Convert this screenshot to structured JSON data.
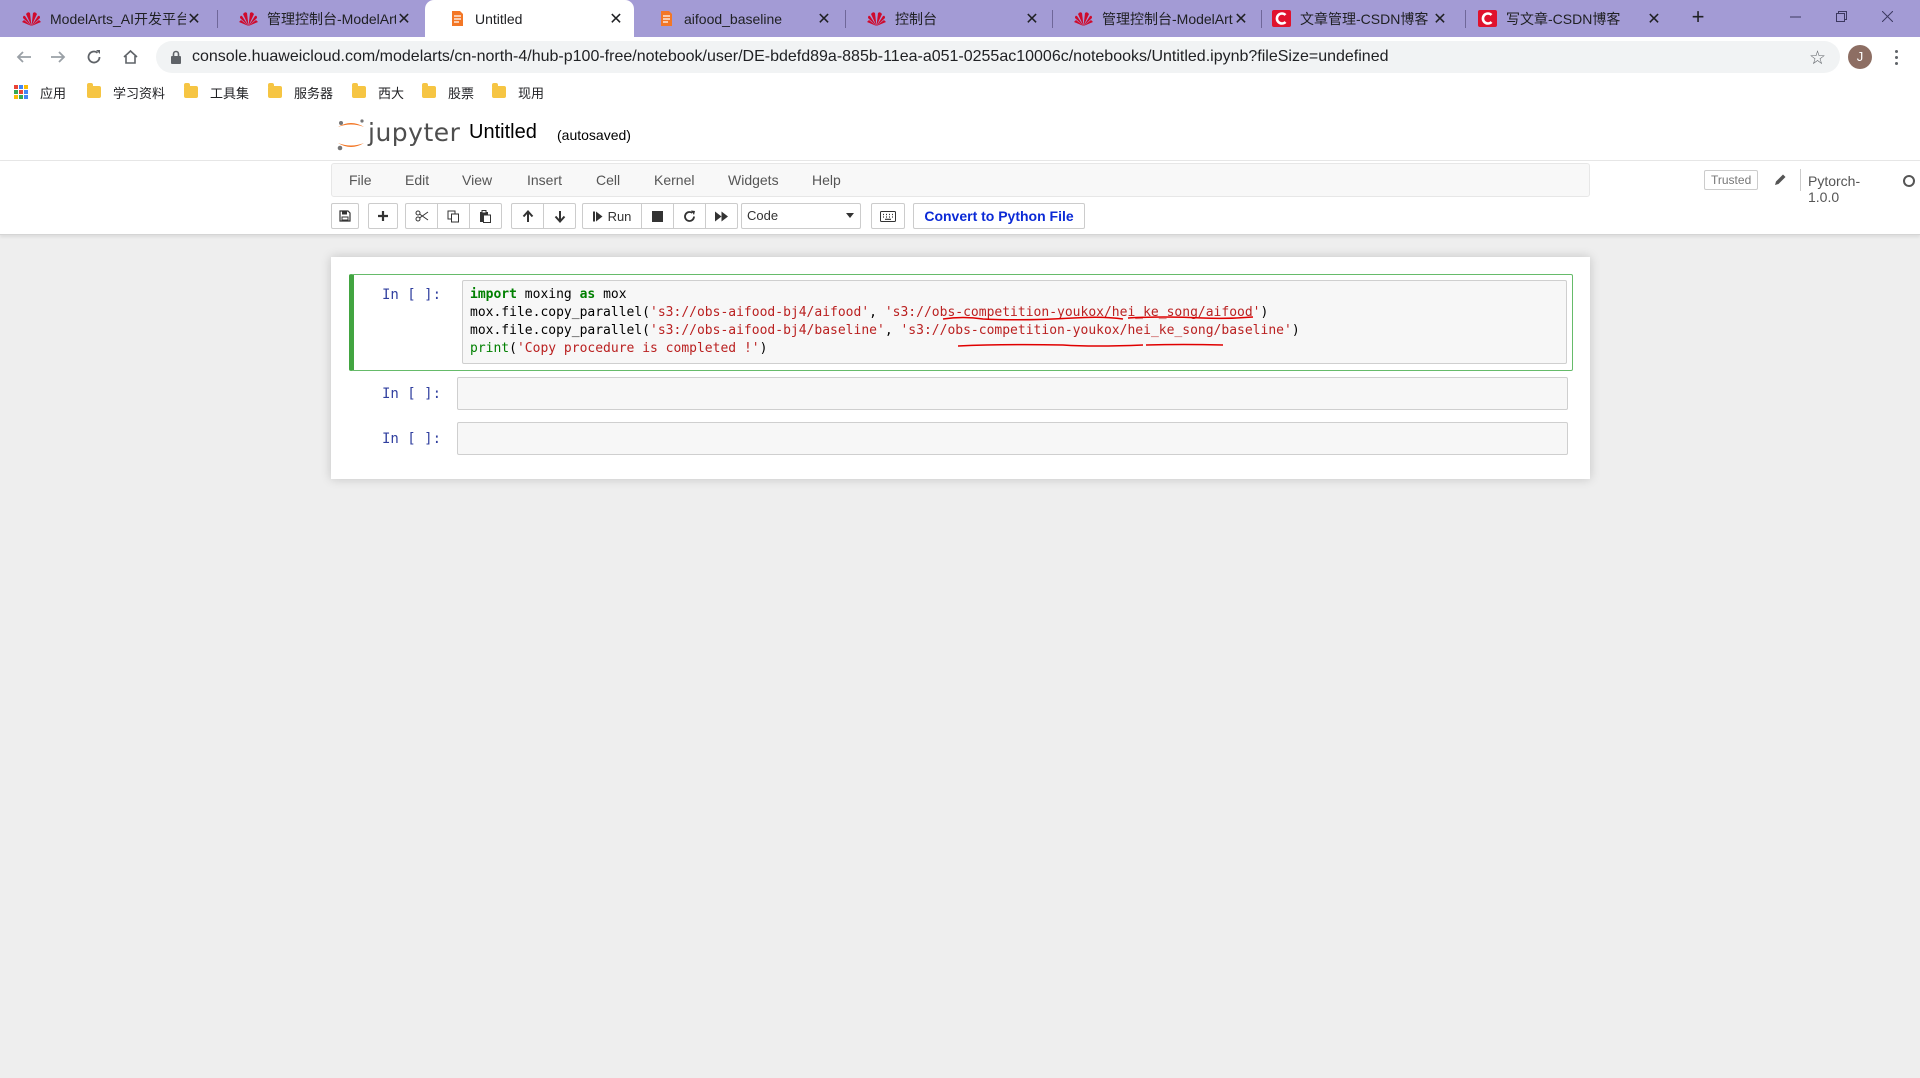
{
  "browser": {
    "tabs": [
      {
        "title": "ModelArts_AI开发平台",
        "favicon": "huawei-icon",
        "active": false
      },
      {
        "title": "管理控制台-ModelArts",
        "favicon": "huawei-icon",
        "active": false
      },
      {
        "title": "Untitled",
        "favicon": "jupyter-icon",
        "active": true
      },
      {
        "title": "aifood_baseline",
        "favicon": "jupyter-icon",
        "active": false
      },
      {
        "title": "控制台",
        "favicon": "huawei-icon",
        "active": false
      },
      {
        "title": "管理控制台-ModelArts",
        "favicon": "huawei-icon",
        "active": false
      },
      {
        "title": "文章管理-CSDN博客",
        "favicon": "csdn-icon",
        "active": false
      },
      {
        "title": "写文章-CSDN博客",
        "favicon": "csdn-icon",
        "active": false
      }
    ],
    "url": "console.huaweicloud.com/modelarts/cn-north-4/hub-p100-free/notebook/user/DE-bdefd89a-885b-11ea-a051-0255ac10006c/notebooks/Untitled.ipynb?fileSize=undefined",
    "profile_initial": "J",
    "bookmarks": [
      "应用",
      "学习资料",
      "工具集",
      "服务器",
      "西大",
      "股票",
      "现用"
    ]
  },
  "jupyter": {
    "logo_text": "jupyter",
    "notebook_name": "Untitled",
    "save_status": "(autosaved)",
    "menu": [
      "File",
      "Edit",
      "View",
      "Insert",
      "Cell",
      "Kernel",
      "Widgets",
      "Help"
    ],
    "trusted": "Trusted",
    "kernel": "Pytorch-1.0.0",
    "toolbar": {
      "run_label": "Run",
      "cell_type": "Code",
      "convert_label": "Convert to Python File"
    },
    "cells": [
      {
        "prompt": "In [ ]:",
        "lines": [
          "import moxing as mox",
          "mox.file.copy_parallel('s3://obs-aifood-bj4/aifood', 's3://obs-competition-youkox/hei_ke_song/aifood')",
          "mox.file.copy_parallel('s3://obs-aifood-bj4/baseline', 's3://obs-competition-youkox/hei_ke_song/baseline')",
          "print('Copy procedure is completed !')"
        ],
        "code_parts": {
          "l1_import": "import",
          "l1_mod": " moxing ",
          "l1_as": "as",
          "l1_alias": " mox",
          "l2_fn": "mox.file.copy_parallel(",
          "l2_src": "'s3://obs-aifood-bj4/aifood'",
          "l2_sep": ", ",
          "l2_dst": "'s3://obs-competition-youkox/hei_ke_song/aifood'",
          "l2_end": ")",
          "l3_fn": "mox.file.copy_parallel(",
          "l3_src": "'s3://obs-aifood-bj4/baseline'",
          "l3_sep": ", ",
          "l3_dst": "'s3://obs-competition-youkox/hei_ke_song/baseline'",
          "l3_end": ")",
          "l4_print": "print",
          "l4_open": "(",
          "l4_str": "'Copy procedure is completed !'",
          "l4_end": ")"
        }
      },
      {
        "prompt": "In [ ]:",
        "lines": []
      },
      {
        "prompt": "In [ ]:",
        "lines": []
      }
    ]
  },
  "colors": {
    "tabstrip_bg": "#a39bd5",
    "selected_cell_border": "#42a541",
    "convert_button_text": "#0b2ad6",
    "annotation_underline": "#e00000",
    "prompt_color": "#303f9f",
    "keyword_green": "#008000",
    "string_red": "#ba2121"
  }
}
